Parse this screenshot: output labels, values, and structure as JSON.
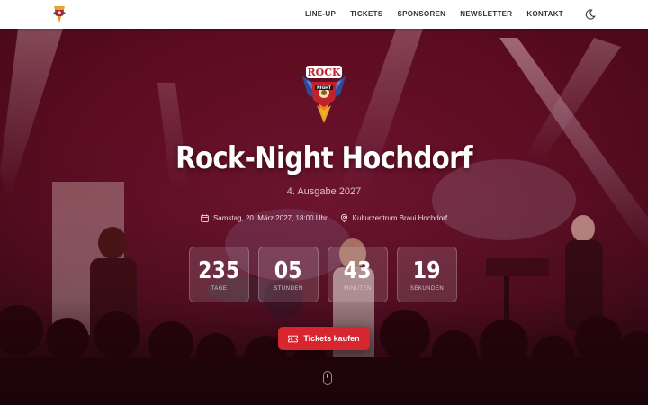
{
  "nav": {
    "items": [
      {
        "label": "LINE-UP"
      },
      {
        "label": "TICKETS"
      },
      {
        "label": "SPONSOREN"
      },
      {
        "label": "NEWSLETTER"
      },
      {
        "label": "KONTAKT"
      }
    ],
    "theme_toggle_icon": "moon-icon"
  },
  "logo": {
    "text_top": "ROCK",
    "text_bottom": "NIGHT"
  },
  "hero": {
    "title": "Rock-Night Hochdorf",
    "edition": "4. Ausgabe 2027",
    "date": "Samstag, 20. März 2027, 18:00 Uhr",
    "date_icon": "calendar-icon",
    "location": "Kulturzentrum Braui Hochdorf",
    "location_icon": "map-pin-icon"
  },
  "countdown": [
    {
      "value": "235",
      "label": "TAGE"
    },
    {
      "value": "05",
      "label": "STUNDEN"
    },
    {
      "value": "43",
      "label": "MINUTEN"
    },
    {
      "value": "19",
      "label": "SEKUNDEN"
    }
  ],
  "cta": {
    "label": "Tickets kaufen",
    "icon": "ticket-icon"
  },
  "scroll_icon": "mouse-scroll-icon",
  "colors": {
    "accent": "#d7262f",
    "overlay": "#7a0a1e"
  }
}
